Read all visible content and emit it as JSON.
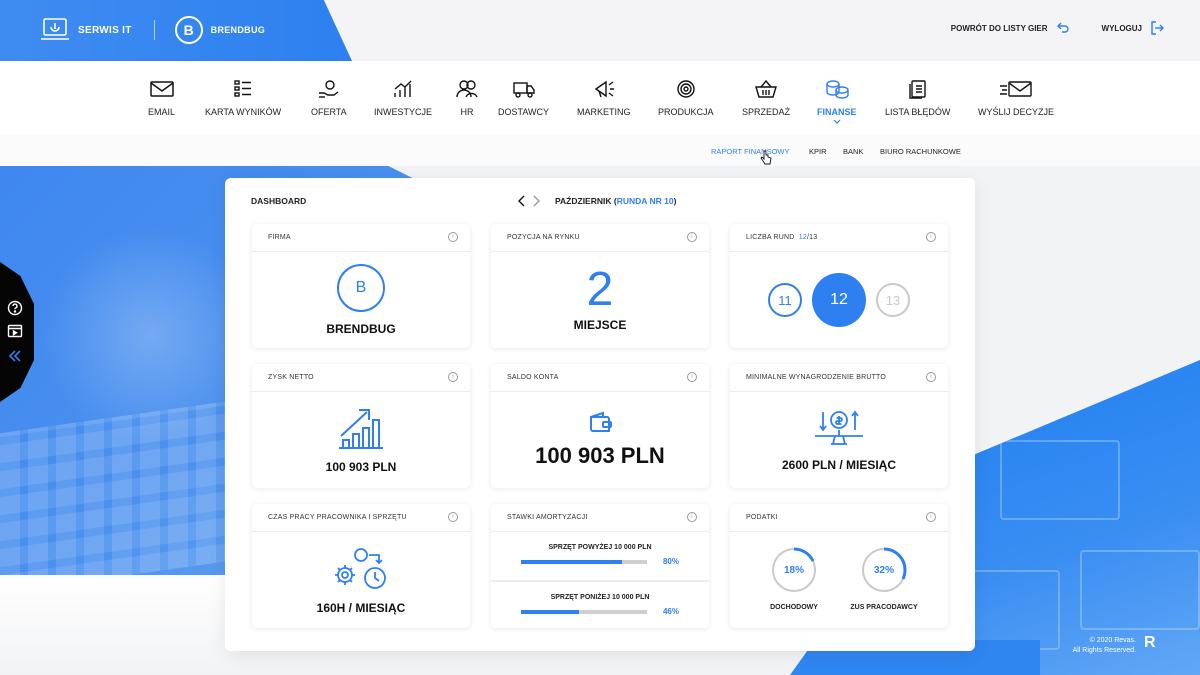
{
  "topbar": {
    "app_name": "SERWIS IT",
    "company_initial": "B",
    "company_name": "BRENDBUG",
    "back_label": "POWRÓT DO LISTY GIER",
    "logout_label": "WYLOGUJ"
  },
  "nav": {
    "items": [
      {
        "label": "EMAIL",
        "icon": "envelope-icon"
      },
      {
        "label": "KARTA WYNIKÓW",
        "icon": "checklist-icon"
      },
      {
        "label": "OFERTA",
        "icon": "hand-coin-icon"
      },
      {
        "label": "INWESTYCJE",
        "icon": "growth-chart-icon"
      },
      {
        "label": "HR",
        "icon": "people-icon"
      },
      {
        "label": "DOSTAWCY",
        "icon": "truck-icon"
      },
      {
        "label": "MARKETING",
        "icon": "megaphone-icon"
      },
      {
        "label": "PRODUKCJA",
        "icon": "gear-target-icon"
      },
      {
        "label": "SPRZEDAŻ",
        "icon": "basket-icon"
      },
      {
        "label": "FINANSE",
        "icon": "coins-icon",
        "active": true
      },
      {
        "label": "LISTA BŁĘDÓW",
        "icon": "document-list-icon"
      },
      {
        "label": "WYŚLIJ DECYZJE",
        "icon": "send-mail-icon"
      }
    ]
  },
  "subnav": {
    "items": [
      {
        "label": "RAPORT FINANSOWY",
        "active": true
      },
      {
        "label": "KPIR"
      },
      {
        "label": "BANK"
      },
      {
        "label": "BIURO RACHUNKOWE"
      }
    ]
  },
  "dashboard": {
    "title": "DASHBOARD",
    "month": "PAŹDZIERNIK",
    "round_label": "RUNDA NR 10",
    "open_paren": "(",
    "close_paren": ")"
  },
  "cards": {
    "firma": {
      "title": "FIRMA",
      "initial": "B",
      "name": "BRENDBUG"
    },
    "pozycja": {
      "title": "POZYCJA NA RYNKU",
      "rank": "2",
      "label": "MIEJSCE"
    },
    "rundy": {
      "title": "LICZBA RUND",
      "count": "12",
      "total": "/13",
      "prev": "11",
      "current": "12",
      "next": "13"
    },
    "zysk": {
      "title": "ZYSK NETTO",
      "value": "100 903 PLN"
    },
    "saldo": {
      "title": "SALDO KONTA",
      "value": "100 903 PLN"
    },
    "wynagrodzenie": {
      "title": "MINIMALNE WYNAGRODZENIE BRUTTO",
      "value": "2600 PLN / MIESIĄC"
    },
    "czas": {
      "title": "CZAS PRACY PRACOWNIKA I SPRZĘTU",
      "value": "160H / MIESIĄC"
    },
    "amortyzacja": {
      "title": "STAWKI AMORTYZACJI",
      "rows": [
        {
          "label": "SPRZĘT POWYŻEJ  10 000 PLN",
          "pct": "80%",
          "fraction": 0.8
        },
        {
          "label": "SPRZĘT PONIŻEJ  10 000 PLN",
          "pct": "46%",
          "fraction": 0.46
        }
      ]
    },
    "podatki": {
      "title": "PODATKI",
      "items": [
        {
          "label": "DOCHODOWY",
          "pct": "18%",
          "fraction": 0.18
        },
        {
          "label": "ZUS PRACODAWCY",
          "pct": "32%",
          "fraction": 0.32
        }
      ]
    }
  },
  "info_glyph": "i",
  "footer": {
    "line1": "© 2020 Revas.",
    "line2": "All Rights Reserved.",
    "logo": "R"
  },
  "colors": {
    "accent": "#2e80f0",
    "muted": "#c9c9c9"
  }
}
